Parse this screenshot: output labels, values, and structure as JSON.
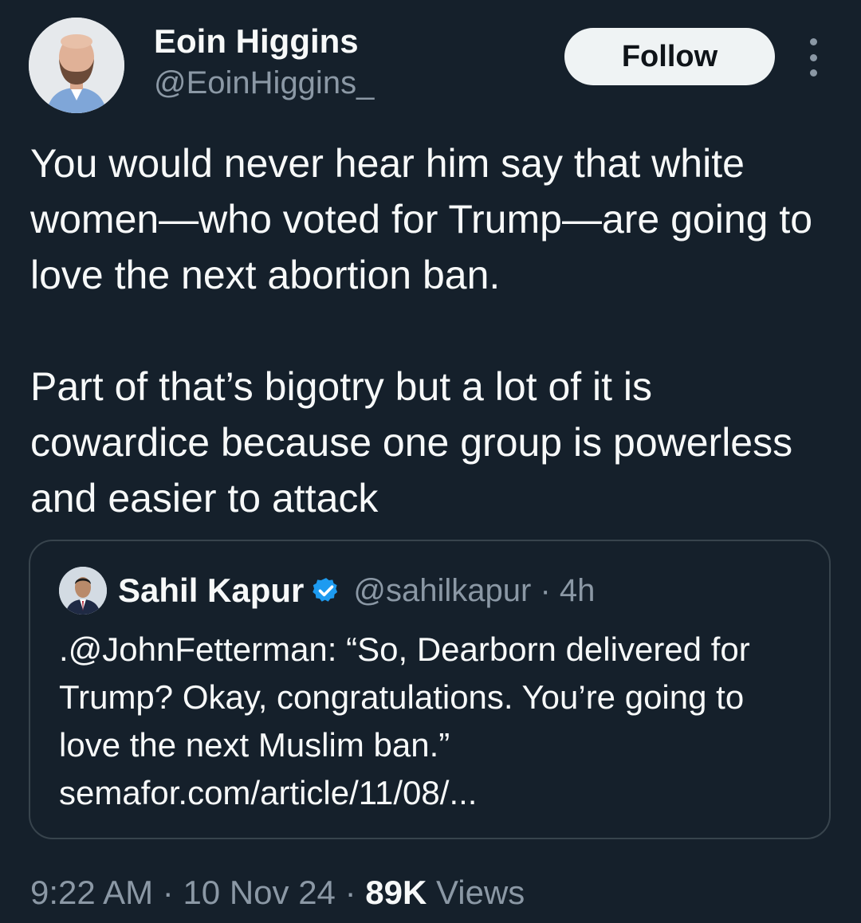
{
  "author": {
    "name": "Eoin Higgins",
    "handle": "@EoinHiggins_",
    "follow_label": "Follow",
    "avatar_icon": "avatar-photo",
    "more_icon": "more-options-icon"
  },
  "tweet": {
    "paragraphs": [
      "You would never hear him say that white women—who voted for Trump—are going to love the next abortion ban.",
      "Part of that’s bigotry but a lot of it is cowardice because one group is powerless and easier to attack"
    ]
  },
  "quoted": {
    "name": "Sahil Kapur",
    "verified_icon": "verified-badge-icon",
    "verified_color": "#1d9bf0",
    "handle": "@sahilkapur",
    "separator": "·",
    "time": "4h",
    "text": ".@JohnFetterman: “So, Dearborn delivered for Trump? Okay, congratulations. You’re going to love the next Muslim ban.” semafor.com/article/11/08/..."
  },
  "meta": {
    "time": "9:22 AM",
    "sep1": "·",
    "date": "10 Nov 24",
    "sep2": "·",
    "views_count": "89K",
    "views_label": "Views"
  },
  "colors": {
    "background": "#15202b",
    "text": "#f7f9f9",
    "muted": "#8b98a5",
    "border": "#38444d",
    "button_bg": "#eff3f4"
  }
}
